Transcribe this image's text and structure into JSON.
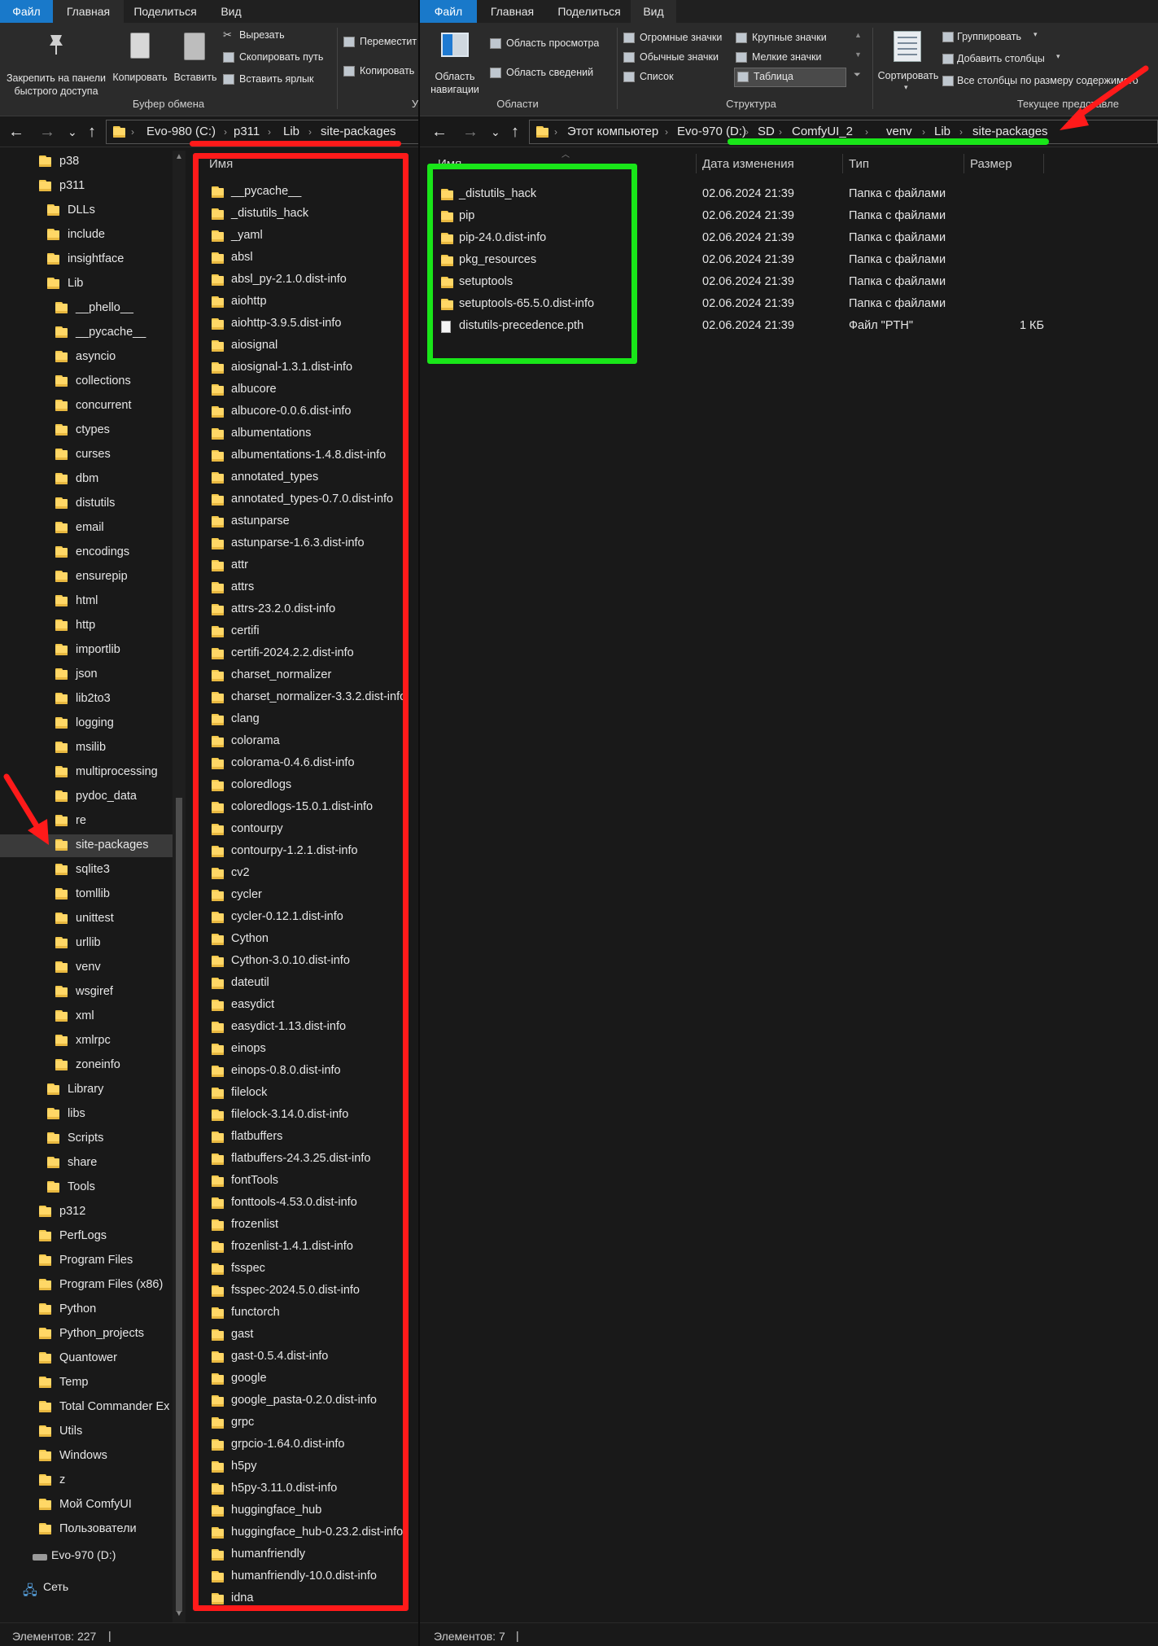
{
  "left_window": {
    "tabs": [
      "Файл",
      "Главная",
      "Поделиться",
      "Вид"
    ],
    "ribbon": {
      "pin_label": "Закрепить на панели быстрого доступа",
      "copy_label": "Копировать",
      "paste_label": "Вставить",
      "cut_label": "Вырезать",
      "copy_path_label": "Скопировать путь",
      "paste_shortcut_label": "Вставить ярлык",
      "move_label": "Переместит",
      "copy_to_label": "Копировать",
      "group_clipboard": "Буфер обмена",
      "group_cut": "У"
    },
    "breadcrumb": [
      "Evo-980 (C:)",
      "p311",
      "Lib",
      "site-packages"
    ],
    "nav_tree": [
      {
        "label": "p38",
        "level": 1
      },
      {
        "label": "p311",
        "level": 1
      },
      {
        "label": "DLLs",
        "level": 2
      },
      {
        "label": "include",
        "level": 2
      },
      {
        "label": "insightface",
        "level": 2
      },
      {
        "label": "Lib",
        "level": 2
      },
      {
        "label": "__phello__",
        "level": 3
      },
      {
        "label": "__pycache__",
        "level": 3
      },
      {
        "label": "asyncio",
        "level": 3
      },
      {
        "label": "collections",
        "level": 3
      },
      {
        "label": "concurrent",
        "level": 3
      },
      {
        "label": "ctypes",
        "level": 3
      },
      {
        "label": "curses",
        "level": 3
      },
      {
        "label": "dbm",
        "level": 3
      },
      {
        "label": "distutils",
        "level": 3
      },
      {
        "label": "email",
        "level": 3
      },
      {
        "label": "encodings",
        "level": 3
      },
      {
        "label": "ensurepip",
        "level": 3
      },
      {
        "label": "html",
        "level": 3
      },
      {
        "label": "http",
        "level": 3
      },
      {
        "label": "importlib",
        "level": 3
      },
      {
        "label": "json",
        "level": 3
      },
      {
        "label": "lib2to3",
        "level": 3
      },
      {
        "label": "logging",
        "level": 3
      },
      {
        "label": "msilib",
        "level": 3
      },
      {
        "label": "multiprocessing",
        "level": 3
      },
      {
        "label": "pydoc_data",
        "level": 3
      },
      {
        "label": "re",
        "level": 3
      },
      {
        "label": "site-packages",
        "level": 3,
        "selected": true
      },
      {
        "label": "sqlite3",
        "level": 3
      },
      {
        "label": "tomllib",
        "level": 3
      },
      {
        "label": "unittest",
        "level": 3
      },
      {
        "label": "urllib",
        "level": 3
      },
      {
        "label": "venv",
        "level": 3
      },
      {
        "label": "wsgiref",
        "level": 3
      },
      {
        "label": "xml",
        "level": 3
      },
      {
        "label": "xmlrpc",
        "level": 3
      },
      {
        "label": "zoneinfo",
        "level": 3
      },
      {
        "label": "Library",
        "level": 2
      },
      {
        "label": "libs",
        "level": 2
      },
      {
        "label": "Scripts",
        "level": 2
      },
      {
        "label": "share",
        "level": 2
      },
      {
        "label": "Tools",
        "level": 2
      },
      {
        "label": "p312",
        "level": 1
      },
      {
        "label": "PerfLogs",
        "level": 1
      },
      {
        "label": "Program Files",
        "level": 1
      },
      {
        "label": "Program Files (x86)",
        "level": 1
      },
      {
        "label": "Python",
        "level": 1
      },
      {
        "label": "Python_projects",
        "level": 1
      },
      {
        "label": "Quantower",
        "level": 1
      },
      {
        "label": "Temp",
        "level": 1
      },
      {
        "label": "Total Commander Ex",
        "level": 1
      },
      {
        "label": "Utils",
        "level": 1
      },
      {
        "label": "Windows",
        "level": 1
      },
      {
        "label": "z",
        "level": 1
      },
      {
        "label": "Мой ComfyUI",
        "level": 1
      },
      {
        "label": "Пользователи",
        "level": 1
      }
    ],
    "drive_label": "Evo-970 (D:)",
    "network_label": "Сеть",
    "column_name": "Имя",
    "files": [
      "__pycache__",
      "_distutils_hack",
      "_yaml",
      "absl",
      "absl_py-2.1.0.dist-info",
      "aiohttp",
      "aiohttp-3.9.5.dist-info",
      "aiosignal",
      "aiosignal-1.3.1.dist-info",
      "albucore",
      "albucore-0.0.6.dist-info",
      "albumentations",
      "albumentations-1.4.8.dist-info",
      "annotated_types",
      "annotated_types-0.7.0.dist-info",
      "astunparse",
      "astunparse-1.6.3.dist-info",
      "attr",
      "attrs",
      "attrs-23.2.0.dist-info",
      "certifi",
      "certifi-2024.2.2.dist-info",
      "charset_normalizer",
      "charset_normalizer-3.3.2.dist-info",
      "clang",
      "colorama",
      "colorama-0.4.6.dist-info",
      "coloredlogs",
      "coloredlogs-15.0.1.dist-info",
      "contourpy",
      "contourpy-1.2.1.dist-info",
      "cv2",
      "cycler",
      "cycler-0.12.1.dist-info",
      "Cython",
      "Cython-3.0.10.dist-info",
      "dateutil",
      "easydict",
      "easydict-1.13.dist-info",
      "einops",
      "einops-0.8.0.dist-info",
      "filelock",
      "filelock-3.14.0.dist-info",
      "flatbuffers",
      "flatbuffers-24.3.25.dist-info",
      "fontTools",
      "fonttools-4.53.0.dist-info",
      "frozenlist",
      "frozenlist-1.4.1.dist-info",
      "fsspec",
      "fsspec-2024.5.0.dist-info",
      "functorch",
      "gast",
      "gast-0.5.4.dist-info",
      "google",
      "google_pasta-0.2.0.dist-info",
      "grpc",
      "grpcio-1.64.0.dist-info",
      "h5py",
      "h5py-3.11.0.dist-info",
      "huggingface_hub",
      "huggingface_hub-0.23.2.dist-info",
      "humanfriendly",
      "humanfriendly-10.0.dist-info",
      "idna"
    ],
    "status": "Элементов: 227"
  },
  "right_window": {
    "tabs": [
      "Файл",
      "Главная",
      "Поделиться",
      "Вид"
    ],
    "ribbon": {
      "nav_pane_label": "Область навигации",
      "preview_pane_label": "Область просмотра",
      "details_pane_label": "Область сведений",
      "group_panes": "Области",
      "layout_items": [
        "Огромные значки",
        "Крупные значки",
        "Обычные значки",
        "Мелкие значки",
        "Список",
        "Таблица"
      ],
      "group_layout": "Структура",
      "sort_label": "Сортировать",
      "group_by_label": "Группировать",
      "add_columns_label": "Добавить столбцы",
      "fit_columns_label": "Все столбцы по размеру содержимого",
      "group_view": "Текущее представле"
    },
    "breadcrumb": [
      "Этот компьютер",
      "Evo-970 (D:)",
      "SD",
      "ComfyUI_2",
      "venv",
      "Lib",
      "site-packages"
    ],
    "columns": [
      "Имя",
      "Дата изменения",
      "Тип",
      "Размер"
    ],
    "files": [
      {
        "name": "_distutils_hack",
        "date": "02.06.2024 21:39",
        "type": "Папка с файлами",
        "size": "",
        "kind": "folder"
      },
      {
        "name": "pip",
        "date": "02.06.2024 21:39",
        "type": "Папка с файлами",
        "size": "",
        "kind": "folder"
      },
      {
        "name": "pip-24.0.dist-info",
        "date": "02.06.2024 21:39",
        "type": "Папка с файлами",
        "size": "",
        "kind": "folder"
      },
      {
        "name": "pkg_resources",
        "date": "02.06.2024 21:39",
        "type": "Папка с файлами",
        "size": "",
        "kind": "folder"
      },
      {
        "name": "setuptools",
        "date": "02.06.2024 21:39",
        "type": "Папка с файлами",
        "size": "",
        "kind": "folder"
      },
      {
        "name": "setuptools-65.5.0.dist-info",
        "date": "02.06.2024 21:39",
        "type": "Папка с файлами",
        "size": "",
        "kind": "folder"
      },
      {
        "name": "distutils-precedence.pth",
        "date": "02.06.2024 21:39",
        "type": "Файл \"PTH\"",
        "size": "1 КБ",
        "kind": "file"
      }
    ],
    "status": "Элементов: 7"
  },
  "annotation_colors": {
    "red": "#ff1a1a",
    "green": "#19e619",
    "selection": "#3a3a3a",
    "file_tab": "#1979ca"
  }
}
